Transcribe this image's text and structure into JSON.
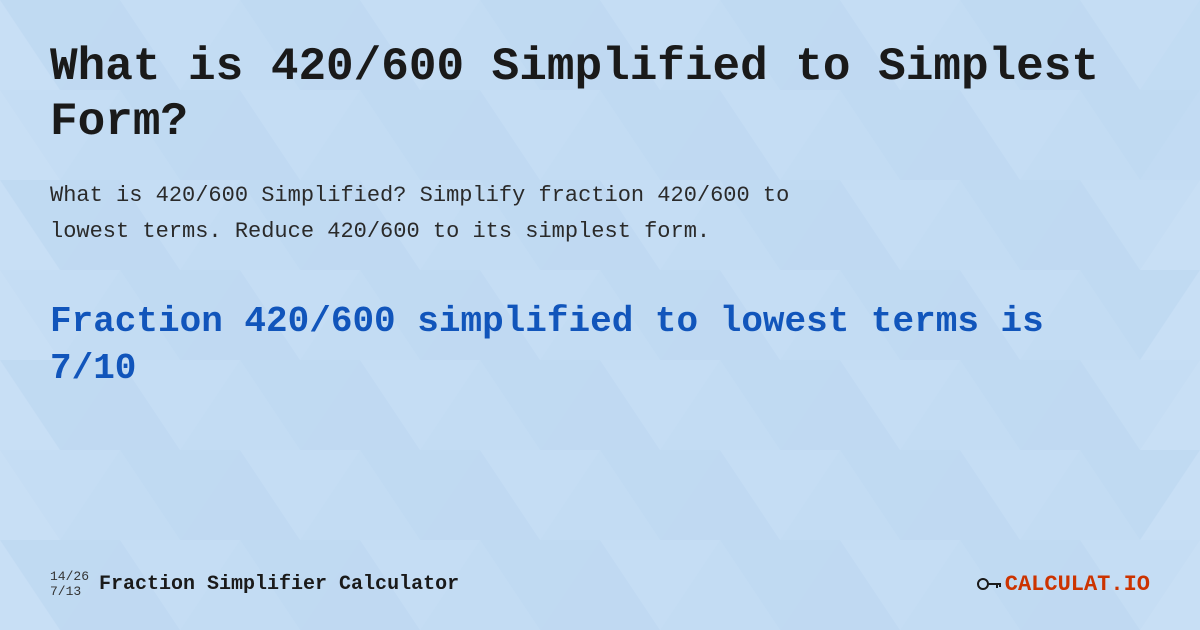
{
  "background": {
    "color": "#c8dff5"
  },
  "title": "What is 420/600 Simplified to Simplest Form?",
  "description_line1": "What is 420/600 Simplified? Simplify fraction 420/600 to",
  "description_line2": "lowest terms. Reduce 420/600 to its simplest form.",
  "result_line1": "Fraction 420/600 simplified to lowest terms is",
  "result_line2": "7/10",
  "footer": {
    "fraction1": "14/26",
    "fraction2": "7/13",
    "site_title": "Fraction Simplifier Calculator",
    "logo_text_main": "CALCULAT",
    "logo_text_accent": ".IO"
  }
}
